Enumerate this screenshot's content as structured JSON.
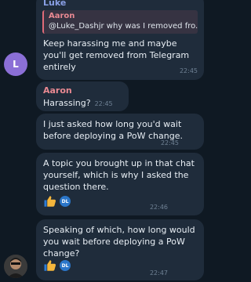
{
  "messages": {
    "m1": {
      "sender": "Luke",
      "reply": {
        "name": "Aaron",
        "text": "@Luke_Dashjr why was I removed fro..."
      },
      "text": "Keep harassing me and maybe\nyou'll get removed from Telegram\nentirely",
      "time": "22:45",
      "avatar_letter": "L"
    },
    "m2": {
      "sender": "Aaron",
      "text": "Harassing?",
      "time": "22:45"
    },
    "m3": {
      "text": "I just asked how long you'd wait\nbefore deploying a PoW change.",
      "time": "22:45"
    },
    "m4": {
      "text": "A topic you brought up in that chat\nyourself, which is why I asked the\nquestion there.",
      "time": "22:46",
      "reactor": "DL"
    },
    "m5": {
      "text": "Speaking of which, how long would\nyou wait before deploying a PoW\nchange?",
      "time": "22:47",
      "reactor": "DL"
    }
  },
  "colors": {
    "background": "#0f1923",
    "bubble": "#1f2c3b",
    "luke_name": "#8aa0e6",
    "aaron_name": "#e98992",
    "avatar_l": "#8b6fd6",
    "reactor_badge": "#2b76c9"
  },
  "icons": {
    "reaction": "thumbs-up-icon",
    "avatar_photo": "avatar-photo"
  }
}
